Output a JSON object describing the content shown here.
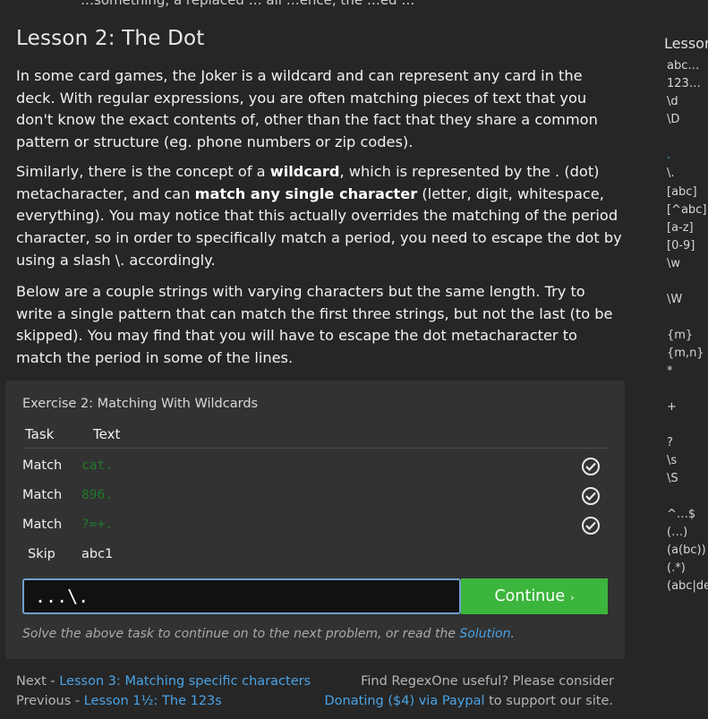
{
  "top_partial": "…something, a replaced … all …ence, the …ed …",
  "lesson": {
    "title": "Lesson 2: The Dot",
    "p1": "In some card games, the Joker is a wildcard and can represent any card in the deck. With regular expressions, you are often matching pieces of text that you don't know the exact contents of, other than the fact that they share a common pattern or structure (eg. phone numbers or zip codes).",
    "p2_a": "Similarly, there is the concept of a ",
    "p2_b": "wildcard",
    "p2_c": ", which is represented by the . (dot) metacharacter, and can ",
    "p2_d": "match any single character",
    "p2_e": " (letter, digit, whitespace, everything). You may notice that this actually overrides the matching of the period character, so in order to specifically match a period, you need to escape the dot by using a slash \\. accordingly.",
    "p3": "Below are a couple strings with varying characters but the same length. Try to write a single pattern that can match the first three strings, but not the last (to be skipped). You may find that you will have to escape the dot metacharacter to match the period in some of the lines."
  },
  "exercise": {
    "title": "Exercise 2: Matching With Wildcards",
    "col_task": "Task",
    "col_text": "Text",
    "rows": [
      {
        "task": "Match",
        "text": "cat."
      },
      {
        "task": "Match",
        "text": "896."
      },
      {
        "task": "Match",
        "text": "?=+."
      },
      {
        "task": "Skip",
        "text": "abc1"
      }
    ],
    "input_value": "...\\.",
    "continue_label": "Continue",
    "hint_prefix": "Solve the above task to continue on to the next problem, or read the ",
    "hint_link": "Solution",
    "hint_suffix": "."
  },
  "footer": {
    "next_prefix": "Next - ",
    "next_link": "Lesson 3: Matching specific characters",
    "prev_prefix": "Previous - ",
    "prev_link": "Lesson 1½: The 123s",
    "find_text": "Find RegexOne useful? Please consider",
    "donate_link": "Donating ($4) via Paypal",
    "donate_suffix": " to support our site."
  },
  "sidebar": {
    "title": "Lessor",
    "items": [
      "abc…",
      "123…",
      "\\d",
      "\\D",
      ".",
      "\\.",
      "[abc]",
      "[^abc]",
      "[a-z]",
      "[0-9]",
      "\\w",
      "\\W",
      "{m}",
      "{m,n}",
      "*",
      "+",
      "?",
      "\\s",
      "\\S",
      "^…$",
      "(…)",
      "(a(bc))",
      "(.*)",
      "(abc|de"
    ]
  },
  "colors": {
    "background": "#262626",
    "exercise_bg": "#323232",
    "link": "#4aa3e6",
    "matched_text": "#1f7a2a",
    "continue_button": "#3cb53c",
    "input_border": "#6fa0cf",
    "sidebar_active": "#4aa3e6"
  }
}
